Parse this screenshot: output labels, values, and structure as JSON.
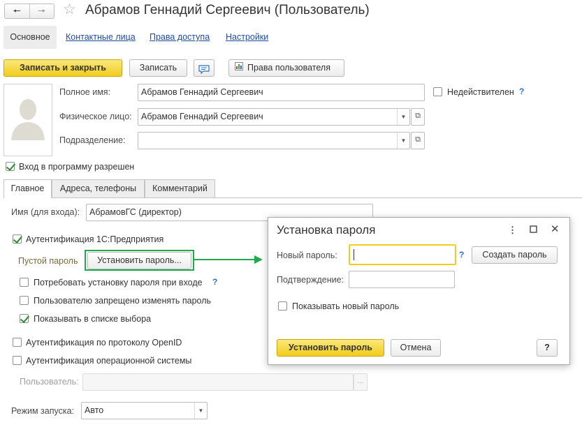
{
  "nav": {
    "back_icon": "arrow-left-icon",
    "forward_icon": "arrow-right-icon",
    "favorite_icon": "star-icon"
  },
  "window_title": "Абрамов Геннадий Сергеевич (Пользователь)",
  "tabs": {
    "main": "Основное",
    "contacts": "Контактные лица",
    "access": "Права доступа",
    "settings": "Настройки"
  },
  "toolbar": {
    "save_close": "Записать и закрыть",
    "save": "Записать",
    "comment_icon": "speech-bubble-icon",
    "user_rights": "Права пользователя"
  },
  "form": {
    "full_name_label": "Полное имя:",
    "full_name_value": "Абрамов Геннадий Сергеевич",
    "invalid_label": "Недействителен",
    "help": "?",
    "individual_label": "Физическое лицо:",
    "individual_value": "Абрамов Геннадий Сергеевич",
    "department_label": "Подразделение:",
    "department_value": "",
    "login_allowed_label": "Вход в программу разрешен"
  },
  "form_tabs": {
    "main": "Главное",
    "addresses": "Адреса, телефоны",
    "comment": "Комментарий"
  },
  "auth": {
    "login_name_label": "Имя (для входа):",
    "login_name_value": "АбрамовГС (директор)",
    "auth_1c_label": "Аутентификация 1С:Предприятия",
    "empty_password_label": "Пустой пароль",
    "set_password_button": "Установить пароль...",
    "require_password_label": "Потребовать установку пароля при входе",
    "forbid_change_label": "Пользователю запрещено изменять пароль",
    "show_in_list_label": "Показывать в списке выбора",
    "openid_label": "Аутентификация по протоколу OpenID",
    "os_auth_label": "Аутентификация операционной системы",
    "os_user_label": "Пользователь:",
    "os_user_value": "",
    "launch_mode_label": "Режим запуска:",
    "launch_mode_value": "Авто"
  },
  "dialog": {
    "title": "Установка пароля",
    "menu_icon": "more-vert-icon",
    "maximize_icon": "maximize-icon",
    "close_icon": "close-icon",
    "new_password_label": "Новый пароль:",
    "new_password_value": "",
    "create_password_button": "Создать пароль",
    "confirm_label": "Подтверждение:",
    "confirm_value": "",
    "show_password_label": "Показывать новый пароль",
    "set_password_button": "Установить пароль",
    "cancel_button": "Отмена",
    "help_button": "?"
  },
  "colors": {
    "primary_button": "#f1cd1d",
    "highlight": "#1faa4b",
    "link": "#1f4ba3",
    "focus": "#f1cd1d"
  }
}
